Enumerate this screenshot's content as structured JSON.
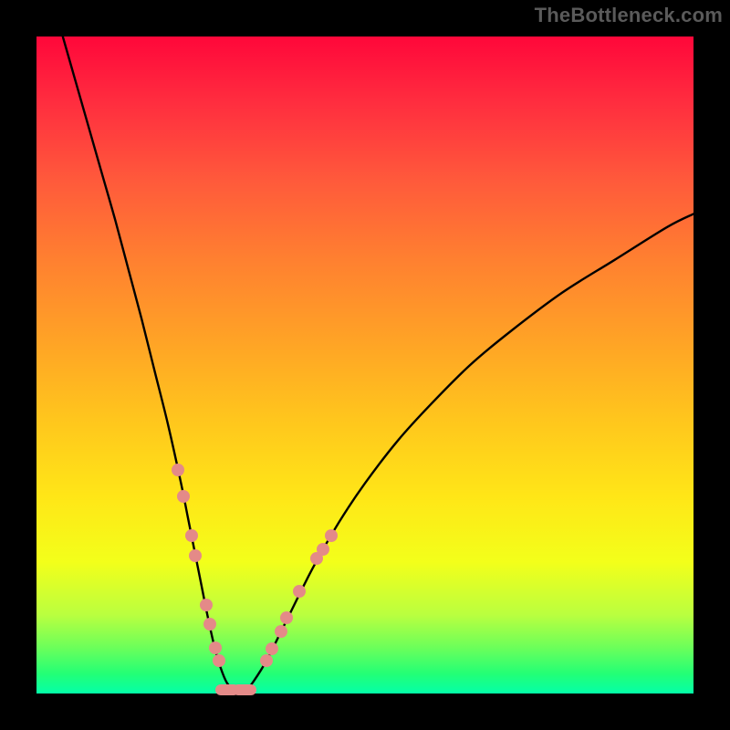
{
  "watermark": "TheBottleneck.com",
  "chart_data": {
    "type": "line",
    "title": "",
    "xlabel": "",
    "ylabel": "",
    "xlim": [
      0,
      100
    ],
    "ylim": [
      0,
      100
    ],
    "grid": false,
    "background_gradient": {
      "from": "#ff073a",
      "to": "#04ffa8",
      "direction": "vertical"
    },
    "series": [
      {
        "name": "bottleneck-curve",
        "color": "#000000",
        "x": [
          4,
          6,
          8,
          10,
          12,
          14,
          16,
          18,
          20,
          22,
          23,
          24,
          25,
          26,
          27,
          28,
          29,
          30,
          31,
          32,
          33,
          35,
          38,
          42,
          46,
          50,
          55,
          60,
          66,
          72,
          80,
          88,
          96,
          100
        ],
        "y": [
          100,
          93,
          86,
          79,
          72,
          64.5,
          57,
          49,
          41,
          32,
          27,
          22,
          17,
          12,
          7.5,
          4,
          1.6,
          0.6,
          0.4,
          0.6,
          1.8,
          5,
          11,
          19,
          26,
          32,
          38.5,
          44,
          50,
          55,
          61,
          66,
          71,
          73
        ]
      }
    ],
    "markers": {
      "name": "highlight-beads",
      "color": "#e48a88",
      "points": [
        {
          "x": 21.5,
          "y": 34
        },
        {
          "x": 22.3,
          "y": 30
        },
        {
          "x": 23.6,
          "y": 24
        },
        {
          "x": 24.2,
          "y": 21
        },
        {
          "x": 25.8,
          "y": 13.5
        },
        {
          "x": 26.4,
          "y": 10.5
        },
        {
          "x": 27.2,
          "y": 7
        },
        {
          "x": 27.8,
          "y": 5
        },
        {
          "x": 35.0,
          "y": 5
        },
        {
          "x": 35.8,
          "y": 6.8
        },
        {
          "x": 37.2,
          "y": 9.5
        },
        {
          "x": 38.0,
          "y": 11.5
        },
        {
          "x": 40.0,
          "y": 15.5
        },
        {
          "x": 42.6,
          "y": 20.5
        },
        {
          "x": 43.6,
          "y": 22
        },
        {
          "x": 44.8,
          "y": 24
        }
      ],
      "flat_points": [
        {
          "x": 29.0,
          "y": 0.6
        },
        {
          "x": 31.6,
          "y": 0.6
        }
      ]
    }
  }
}
